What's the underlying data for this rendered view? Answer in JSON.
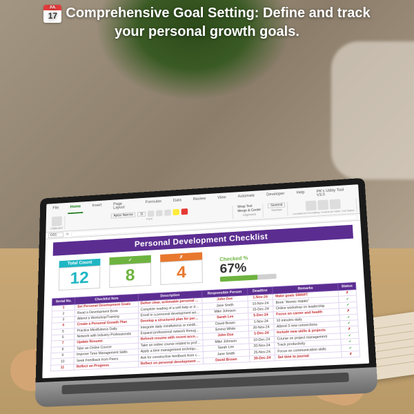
{
  "overlay": {
    "calendar_month": "JUL",
    "calendar_day": "17",
    "title_line1": "Comprehensive Goal Setting: Define and track",
    "title_line2": "your personal growth goals."
  },
  "ribbon": {
    "tabs": {
      "file": "File",
      "home": "Home",
      "insert": "Insert",
      "page_layout": "Page Layout",
      "formulas": "Formulas",
      "data": "Data",
      "review": "Review",
      "view": "View",
      "automate": "Automate",
      "developer": "Developer",
      "help": "Help",
      "utility": "PK's Utility Tool V3.0"
    },
    "font_name": "Aptos Narrow",
    "font_size": "11",
    "groups": {
      "clipboard": "Clipboard",
      "font": "Font",
      "alignment": "Alignment",
      "number": "Number",
      "wrap": "Wrap Text",
      "merge": "Merge & Center",
      "general": "General",
      "cond_fmt": "Conditional Formatting",
      "fmt_table": "Format as Table",
      "cell_styles": "Cell Styles"
    },
    "cell_ref": "O31",
    "fx": "fx"
  },
  "sheet": {
    "title": "Personal Development Checklist",
    "cards": {
      "total_label": "Total Count",
      "total_value": "12",
      "ok_icon": "✓",
      "ok_value": "8",
      "bad_icon": "✗",
      "bad_value": "4",
      "pct_label": "Checked %",
      "pct_value": "67%"
    },
    "columns": {
      "serial": "Serial No.",
      "item": "Checklist Item",
      "desc": "Description",
      "person": "Responsible Person",
      "deadline": "Deadline",
      "remarks": "Remarks",
      "status": "Status"
    },
    "rows": [
      {
        "n": "1",
        "item": "Set Personal Development Goals",
        "desc": "Define clear, actionable personal development go",
        "person": "John Doe",
        "deadline": "1-Nov-24",
        "remarks": "Make goals SMART",
        "status": "✗",
        "red": true
      },
      {
        "n": "2",
        "item": "Read a Development Book",
        "desc": "Complete reading of a self-help or development bo",
        "person": "Jane Smith",
        "deadline": "10-Nov-24",
        "remarks": "Book \"Atomic Habits\"",
        "status": "✓"
      },
      {
        "n": "3",
        "item": "Attend a Workshop/Training",
        "desc": "Enroll in a personal development workshop or training",
        "person": "Mike Johnson",
        "deadline": "15-Dec-24",
        "remarks": "Online workshop on leadership",
        "status": "✓"
      },
      {
        "n": "4",
        "item": "Create a Personal Growth Plan",
        "desc": "Develop a structured plan for personal growth",
        "person": "Sarah Lee",
        "deadline": "5-Dec-24",
        "remarks": "Focus on career and health",
        "status": "✗",
        "red": true
      },
      {
        "n": "5",
        "item": "Practice Mindfulness Daily",
        "desc": "Integrate daily mindfulness or meditation into routi",
        "person": "David Brown",
        "deadline": "1-Nov-24",
        "remarks": "10 minutes daily",
        "status": "✓"
      },
      {
        "n": "6",
        "item": "Network with Industry Professionals",
        "desc": "Expand professional network through events or Linke",
        "person": "Emma White",
        "deadline": "30-Nov-24",
        "remarks": "Attend 3 new connections",
        "status": "✓"
      },
      {
        "n": "7",
        "item": "Update Resume",
        "desc": "Refresh resume with recent accomplishments",
        "person": "John Doe",
        "deadline": "1-Dec-24",
        "remarks": "Include new skills & projects",
        "status": "✗",
        "red": true
      },
      {
        "n": "8",
        "item": "Take an Online Course",
        "desc": "Take an online course related to professional deve",
        "person": "Mike Johnson",
        "deadline": "10-Dec-24",
        "remarks": "Course on project management",
        "status": "✓"
      },
      {
        "n": "9",
        "item": "Improve Time Management Skills",
        "desc": "Apply a time management technique like Pomod",
        "person": "Sarah Lee",
        "deadline": "20-Nov-24",
        "remarks": "Track productivity",
        "status": "✓"
      },
      {
        "n": "10",
        "item": "Seek Feedback from Peers",
        "desc": "Ask for constructive feedback from colleagues",
        "person": "Jane Smith",
        "deadline": "25-Nov-24",
        "remarks": "Focus on communication skills",
        "status": "✓"
      },
      {
        "n": "11",
        "item": "Reflect on Progress",
        "desc": "Reflect on personal development progress eac",
        "person": "David Brown",
        "deadline": "30-Dec-24",
        "remarks": "Set time to journal",
        "status": "✗",
        "red": true
      }
    ]
  }
}
